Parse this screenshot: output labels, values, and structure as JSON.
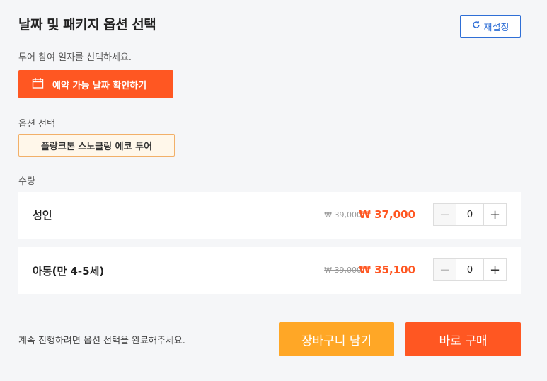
{
  "header": {
    "title": "날짜 및 패키지 옵션 선택",
    "reset_label": "재설정"
  },
  "date": {
    "hint": "투어 참여 일자를 선택하세요.",
    "button_label": "예약 가능 날짜 확인하기"
  },
  "options": {
    "label": "옵션 선택",
    "selected": "플랑크톤 스노클링 에코 투어"
  },
  "quantity": {
    "label": "수량",
    "rows": [
      {
        "name": "성인",
        "old_price": "₩ 39,000",
        "price": "₩ 37,000",
        "count": "0"
      },
      {
        "name": "아동(만 4-5세)",
        "old_price": "₩ 39,000",
        "price": "₩ 35,100",
        "count": "0"
      }
    ]
  },
  "footer": {
    "notice": "계속 진행하려면 옵션 선택을 완료해주세요.",
    "cart_label": "장바구니 담기",
    "buy_label": "바로 구매"
  },
  "stepper": {
    "minus": "−",
    "plus": "+"
  },
  "colors": {
    "accent": "#ff5722",
    "cart": "#ffa726",
    "link_blue": "#2f6fd6",
    "chip_border": "#f2b069",
    "chip_bg": "#fff7ea"
  },
  "icons": {
    "reset": "refresh-icon",
    "calendar": "calendar-icon"
  }
}
